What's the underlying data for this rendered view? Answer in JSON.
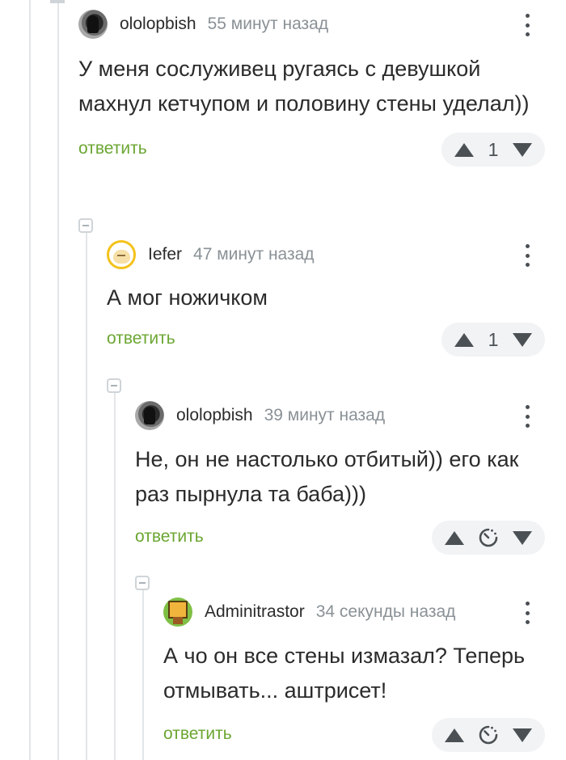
{
  "comments": [
    {
      "username": "ololopbish",
      "time": "55 минут назад",
      "text": "У меня сослуживец ругаясь с девушкой махнул кетчупом и половину стены уделал))",
      "reply": "ответить",
      "rating": "1",
      "avatar": "dark-photo-avatar"
    },
    {
      "username": "Iefer",
      "time": "47 минут назад",
      "text": "А мог ножичком",
      "reply": "ответить",
      "rating": "1",
      "avatar": "yellow-cartoon-avatar"
    },
    {
      "username": "ololopbish",
      "time": "39 минут назад",
      "text": "Не, он не настолько отбитый)) его как раз пырнула та баба)))",
      "reply": "ответить",
      "rating_icon": "timer-icon",
      "avatar": "dark-photo-avatar"
    },
    {
      "username": "Adminitrastor",
      "time": "34 секунды назад",
      "text": "А чо он все стены измазал? Теперь отмывать... аштрисет!",
      "reply": "ответить",
      "rating_icon": "timer-icon",
      "avatar": "pixel-character-avatar"
    }
  ],
  "colors": {
    "reply_link": "#6ba632",
    "vote_bg": "#f1f3f5",
    "thread_line": "#e3e6e8",
    "muted_text": "#8a9196"
  }
}
